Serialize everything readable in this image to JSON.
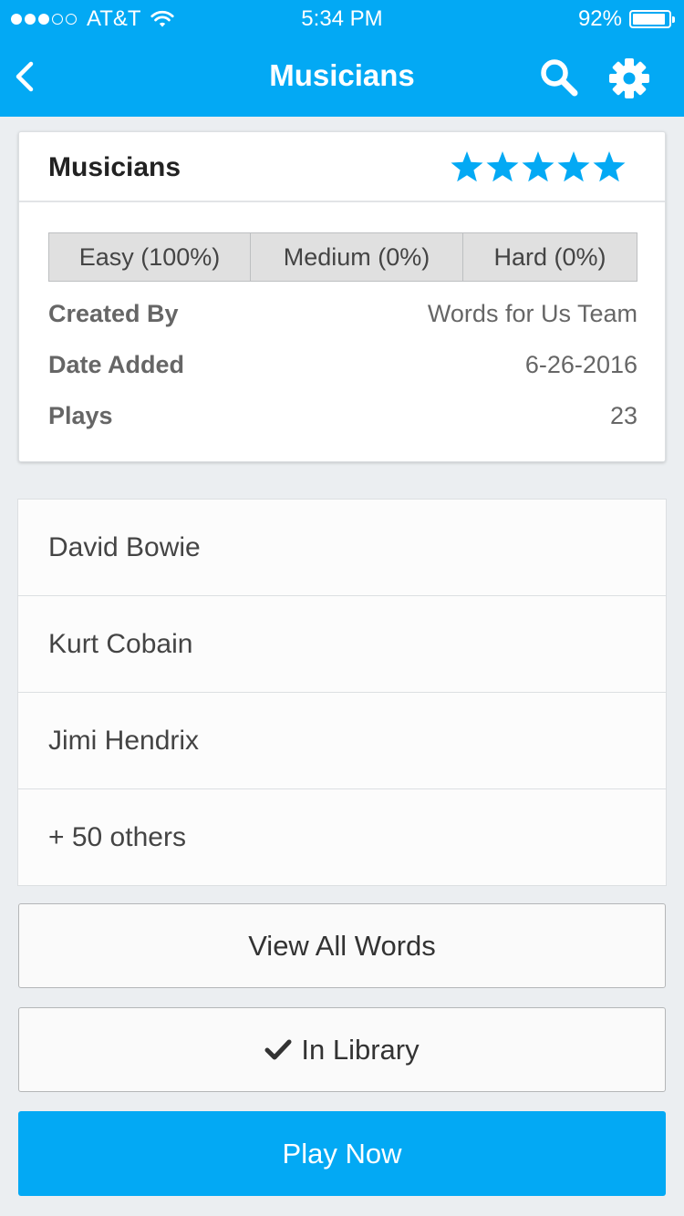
{
  "status_bar": {
    "signal_dots": 5,
    "signal_strength": 3,
    "carrier": "AT&T",
    "time": "5:34 PM",
    "battery_percent": "92%",
    "battery_level": 0.92
  },
  "nav": {
    "title": "Musicians",
    "back_icon": "chevron-left-icon",
    "search_icon": "search-icon",
    "settings_icon": "gear-icon"
  },
  "card": {
    "title": "Musicians",
    "rating": 5,
    "rating_max": 5,
    "difficulty": {
      "easy": "Easy (100%)",
      "medium": "Medium (0%)",
      "hard": "Hard (0%)"
    },
    "info": [
      {
        "label": "Created By",
        "value": "Words for Us Team"
      },
      {
        "label": "Date Added",
        "value": "6-26-2016"
      },
      {
        "label": "Plays",
        "value": "23"
      }
    ]
  },
  "words": [
    "David Bowie",
    "Kurt Cobain",
    "Jimi Hendrix",
    "+ 50 others"
  ],
  "buttons": {
    "view_all": "View All Words",
    "in_library": "In Library",
    "play_now": "Play Now"
  },
  "colors": {
    "accent": "#03a9f4",
    "background": "#ebeef1"
  }
}
